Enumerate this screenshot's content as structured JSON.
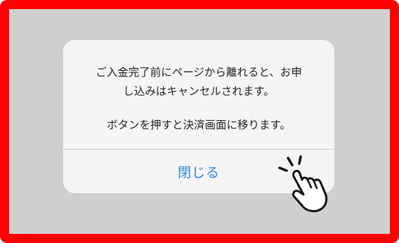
{
  "dialog": {
    "message_line1": "ご入金完了前にページから離れると、お申",
    "message_line2": "し込みはキャンセルされます。",
    "message_line3": "ボタンを押すと決済画面に移ります。",
    "close_label": "閉じる"
  },
  "colors": {
    "frame_border": "#ff0000",
    "backdrop": "#cfcfcf",
    "dialog_background": "#f5f5f5",
    "button_text": "#2e86d8"
  },
  "icons": {
    "pointer": "tap-hand-icon"
  }
}
